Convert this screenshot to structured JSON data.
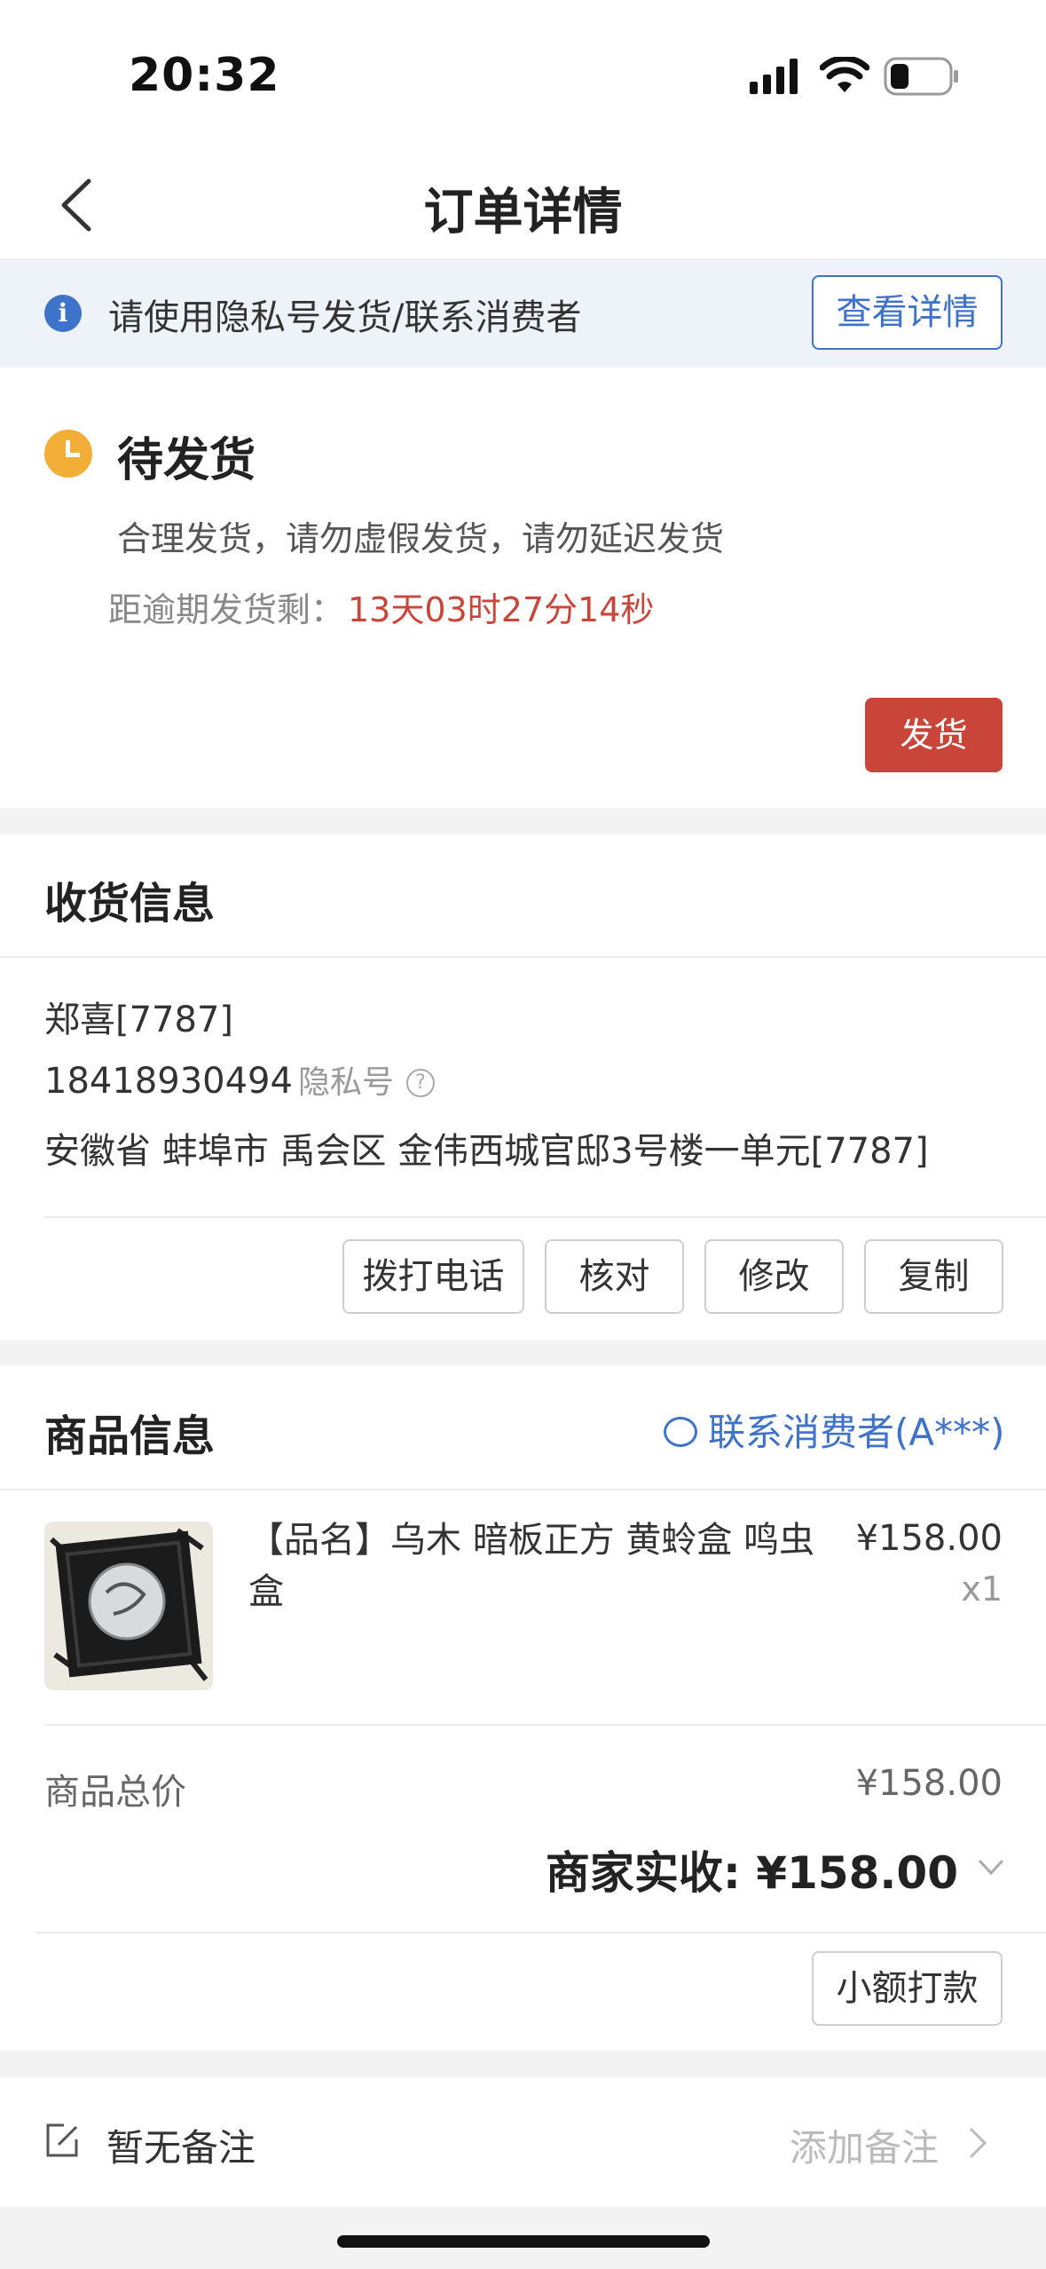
{
  "status_bar": {
    "time": "20:32"
  },
  "nav": {
    "title": "订单详情"
  },
  "notice": {
    "text": "请使用隐私号发货/联系消费者",
    "button": "查看详情",
    "icon": "info-icon"
  },
  "status": {
    "title": "待发货",
    "desc": "合理发货，请勿虚假发货，请勿延迟发货",
    "countdown_label": "距逾期发货剩：",
    "countdown_value": "13天03时27分14秒",
    "ship_button": "发货"
  },
  "receiver": {
    "section_title": "收货信息",
    "name": "郑喜[7787]",
    "phone": "18418930494",
    "phone_tag": "隐私号",
    "address": "安徽省 蚌埠市 禹会区 金伟西城官邸3号楼一单元[7787]",
    "buttons": [
      "拨打电话",
      "核对",
      "修改",
      "复制"
    ]
  },
  "goods": {
    "section_title": "商品信息",
    "contact": "联系消费者(A***)",
    "item": {
      "name": "【品名】乌木 暗板正方 黄蛉盒 鸣虫盒",
      "price": "¥158.00",
      "qty": "x1"
    },
    "total_label": "商品总价",
    "total_value": "¥158.00",
    "merchant_receive": "商家实收: ¥158.00",
    "small_payment_button": "小额打款"
  },
  "remark": {
    "text": "暂无备注",
    "add": "添加备注"
  },
  "colors": {
    "accent": "#3f72c9",
    "danger": "#c9453a",
    "warning": "#f3ae38"
  }
}
